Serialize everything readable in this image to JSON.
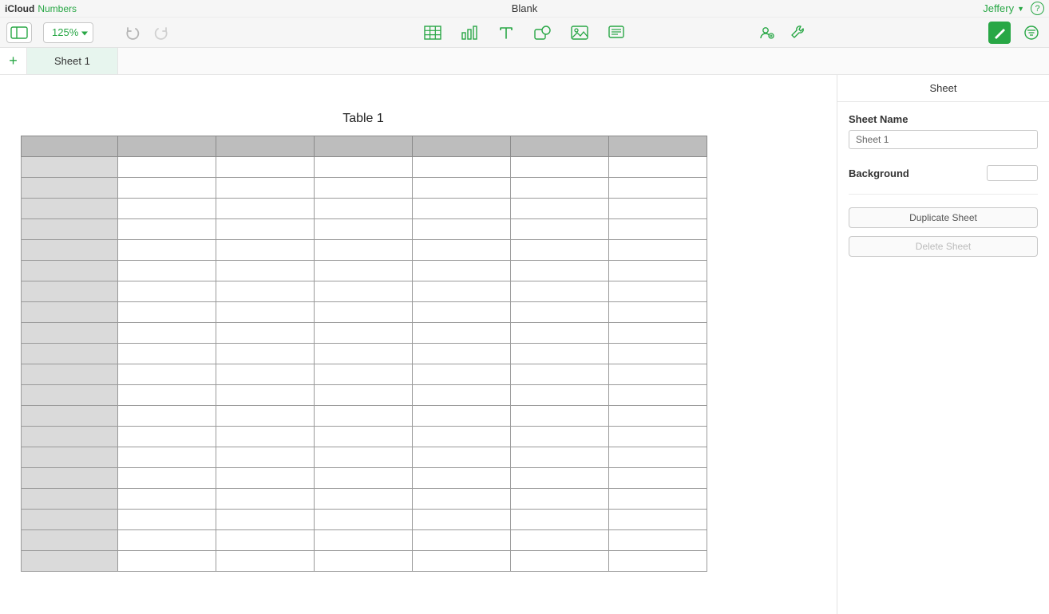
{
  "header": {
    "brand_icloud": "iCloud",
    "brand_app": "Numbers",
    "document_title": "Blank",
    "user_name": "Jeffery",
    "help_label": "?"
  },
  "toolbar": {
    "zoom": "125%"
  },
  "sheets": {
    "tabs": [
      {
        "label": "Sheet 1"
      }
    ],
    "add_label": "+"
  },
  "canvas": {
    "table_title": "Table 1",
    "columns": 7,
    "rows": 20
  },
  "inspector": {
    "tab_label": "Sheet",
    "sheet_name_label": "Sheet Name",
    "sheet_name_value": "Sheet 1",
    "background_label": "Background",
    "background_color": "#ffffff",
    "duplicate_label": "Duplicate Sheet",
    "delete_label": "Delete Sheet"
  }
}
